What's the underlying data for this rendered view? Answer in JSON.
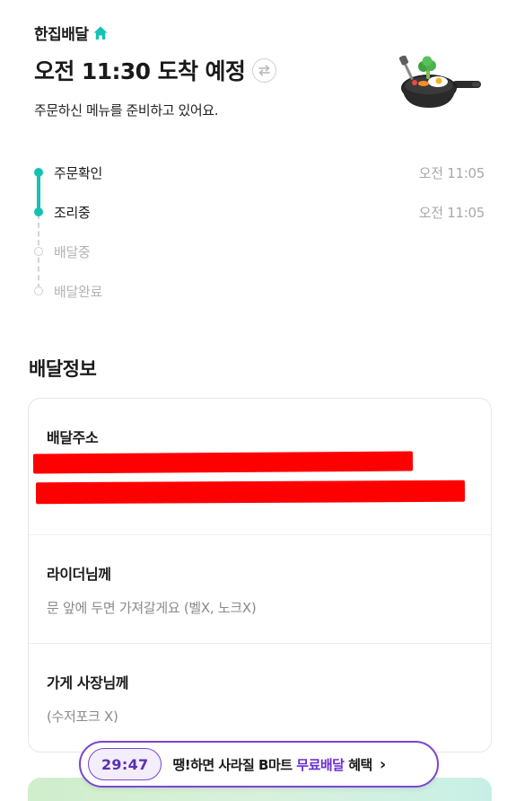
{
  "header": {
    "service_name": "한집배달",
    "eta": "오전 11:30 도착 예정",
    "status_message": "주문하신 메뉴를 준비하고 있어요."
  },
  "steps": [
    {
      "label": "주문확인",
      "time": "오전 11:05",
      "done": true
    },
    {
      "label": "조리중",
      "time": "오전 11:05",
      "done": true
    },
    {
      "label": "배달중",
      "time": "",
      "done": false
    },
    {
      "label": "배달완료",
      "time": "",
      "done": false
    }
  ],
  "delivery_info": {
    "title": "배달정보",
    "address_heading": "배달주소",
    "rider_heading": "라이더님께",
    "rider_request": "문 앞에 두면 가져갈게요 (벨X, 노크X)",
    "store_heading": "가게 사장님께",
    "store_request": "(수저포크 X)"
  },
  "promo": {
    "timer": "29:47",
    "text_before": "땡!하면 사라질 B마트 ",
    "text_highlight": "무료배달",
    "text_after": " 혜택"
  },
  "colors": {
    "accent": "#13c2b3",
    "promo": "#7a45d0",
    "redaction": "#ff0000"
  },
  "icons": {
    "home": "home-icon",
    "swap": "swap-icon",
    "illustration": "frying-pan-icon",
    "chevron": "chevron-right-icon"
  }
}
